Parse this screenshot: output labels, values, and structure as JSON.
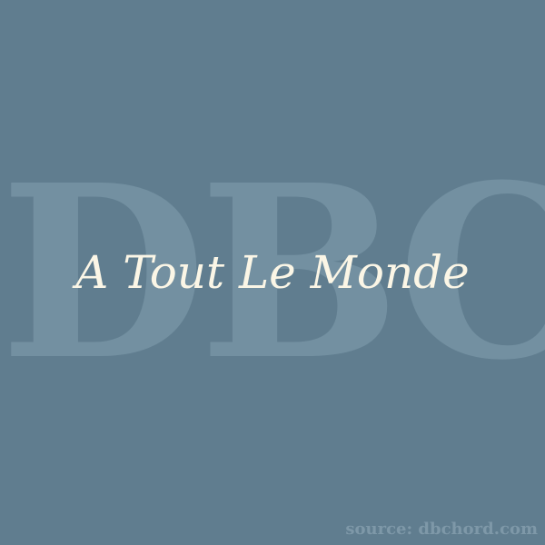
{
  "background_color": "#607d8f",
  "watermark": {
    "text": "DBC",
    "color": "#7390a1"
  },
  "title": {
    "text": "A Tout Le Monde",
    "color": "#fbf6e6"
  },
  "source": {
    "text": "source: dbchord.com",
    "color": "#7e98a8"
  }
}
